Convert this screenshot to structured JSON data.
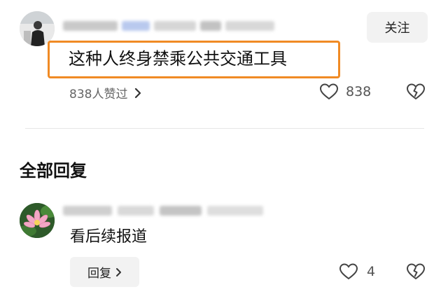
{
  "comment": {
    "follow_label": "关注",
    "text": "这种人终身禁乘公共交通工具",
    "likes_summary": "838人赞过",
    "like_count": "838"
  },
  "replies_section": {
    "title": "全部回复"
  },
  "reply": {
    "text": "看后续报道",
    "reply_button_label": "回复",
    "like_count": "4"
  },
  "colors": {
    "highlight": "#f08a24",
    "button_bg": "#f2f2f2"
  },
  "icons": [
    "heart-outline-icon",
    "dislike-heart-icon",
    "chevron-right-icon"
  ]
}
